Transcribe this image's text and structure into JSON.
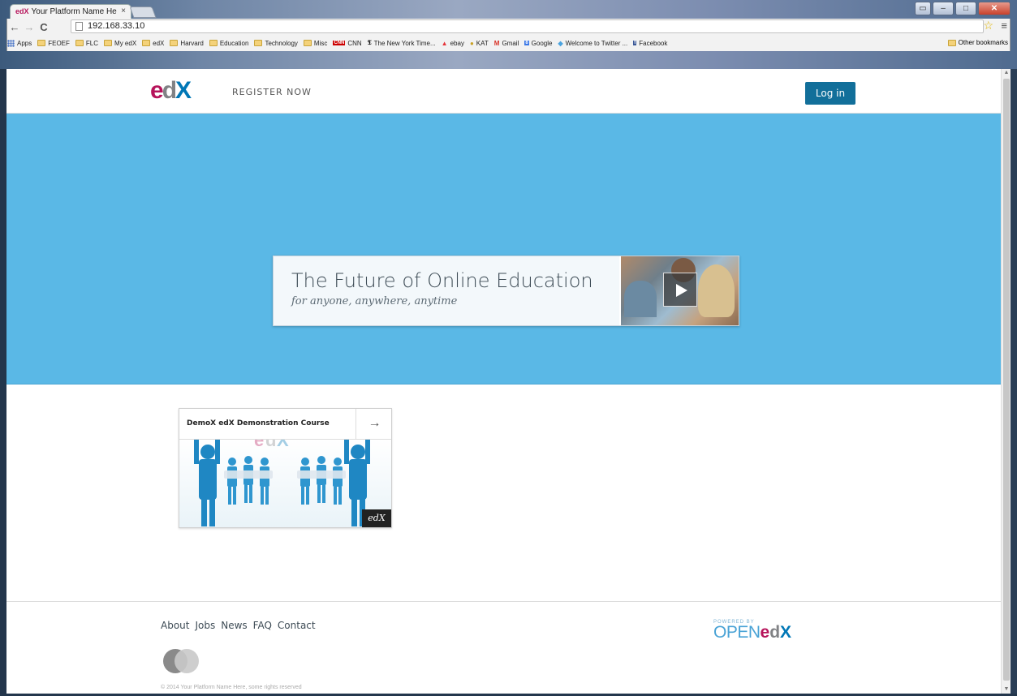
{
  "browser": {
    "tab_title": "Your Platform Name Her",
    "tab_favicon": "edX",
    "tab_close": "×",
    "url": "192.168.33.10",
    "bookmarks": [
      {
        "label": "Apps",
        "icon": "apps-icon"
      },
      {
        "label": "FEOEF",
        "icon": "folder-icon"
      },
      {
        "label": "FLC",
        "icon": "folder-icon"
      },
      {
        "label": "My edX",
        "icon": "folder-icon"
      },
      {
        "label": "edX",
        "icon": "folder-icon"
      },
      {
        "label": "Harvard",
        "icon": "folder-icon"
      },
      {
        "label": "Education",
        "icon": "folder-icon"
      },
      {
        "label": "Technology",
        "icon": "folder-icon"
      },
      {
        "label": "Misc",
        "icon": "folder-icon"
      },
      {
        "label": "CNN",
        "icon": "cnn-icon"
      },
      {
        "label": "The New York Time...",
        "icon": "nyt-icon"
      },
      {
        "label": "ebay",
        "icon": "ebay-icon"
      },
      {
        "label": "KAT",
        "icon": "kat-icon"
      },
      {
        "label": "Gmail",
        "icon": "gmail-icon"
      },
      {
        "label": "Google",
        "icon": "google-icon"
      },
      {
        "label": "Welcome to Twitter ...",
        "icon": "twitter-icon"
      },
      {
        "label": "Facebook",
        "icon": "facebook-icon"
      }
    ],
    "other_bookmarks": "Other bookmarks"
  },
  "header": {
    "register_label": "REGISTER NOW",
    "login_label": "Log in"
  },
  "hero": {
    "title": "The Future of Online Education",
    "subtitle": "for anyone, anywhere, anytime"
  },
  "courses": [
    {
      "title": "DemoX edX Demonstration Course",
      "badge": "edX",
      "arrow": "→"
    }
  ],
  "footer": {
    "links": [
      "About",
      "Jobs",
      "News",
      "FAQ",
      "Contact"
    ],
    "copyright": "© 2014 Your Platform Name Here, some rights reserved",
    "powered_by": "POWERED BY",
    "powered_open": "OPEN",
    "powered_edx": "edX"
  },
  "colors": {
    "hero_bg": "#5ab8e6",
    "login_bg": "#126f9a",
    "edx_pink": "#b6135a",
    "edx_blue": "#0077b6"
  }
}
